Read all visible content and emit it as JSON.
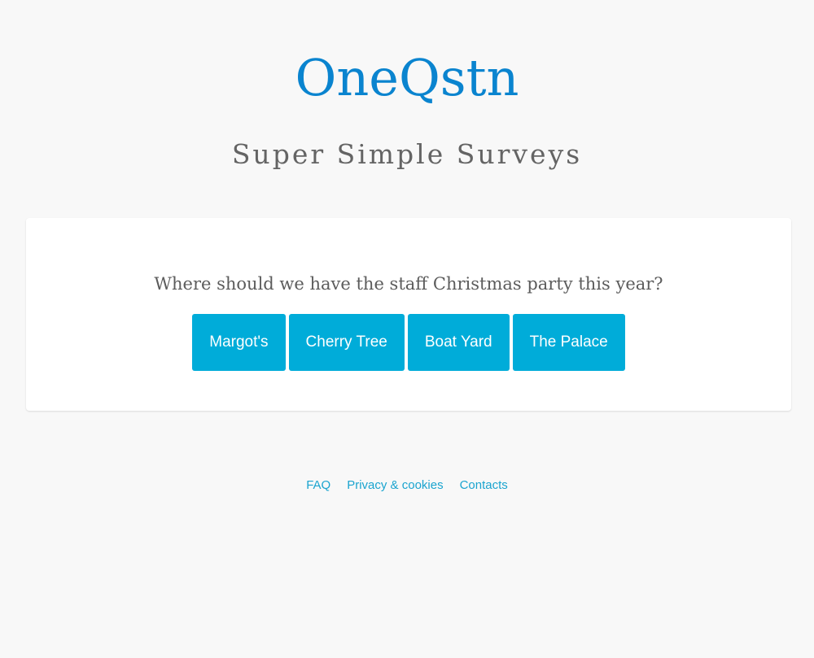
{
  "header": {
    "brand": "OneQstn",
    "tagline": "Super Simple Surveys"
  },
  "survey": {
    "question": "Where should we have the staff Christmas party this year?",
    "answers": [
      "Margot's",
      "Cherry Tree",
      "Boat Yard",
      "The Palace"
    ]
  },
  "footer": {
    "links": [
      "FAQ",
      "Privacy & cookies",
      "Contacts"
    ]
  },
  "colors": {
    "brand": "#0a84cf",
    "button": "#00acd9",
    "link": "#1aa4cf",
    "background": "#f8f8f8"
  }
}
